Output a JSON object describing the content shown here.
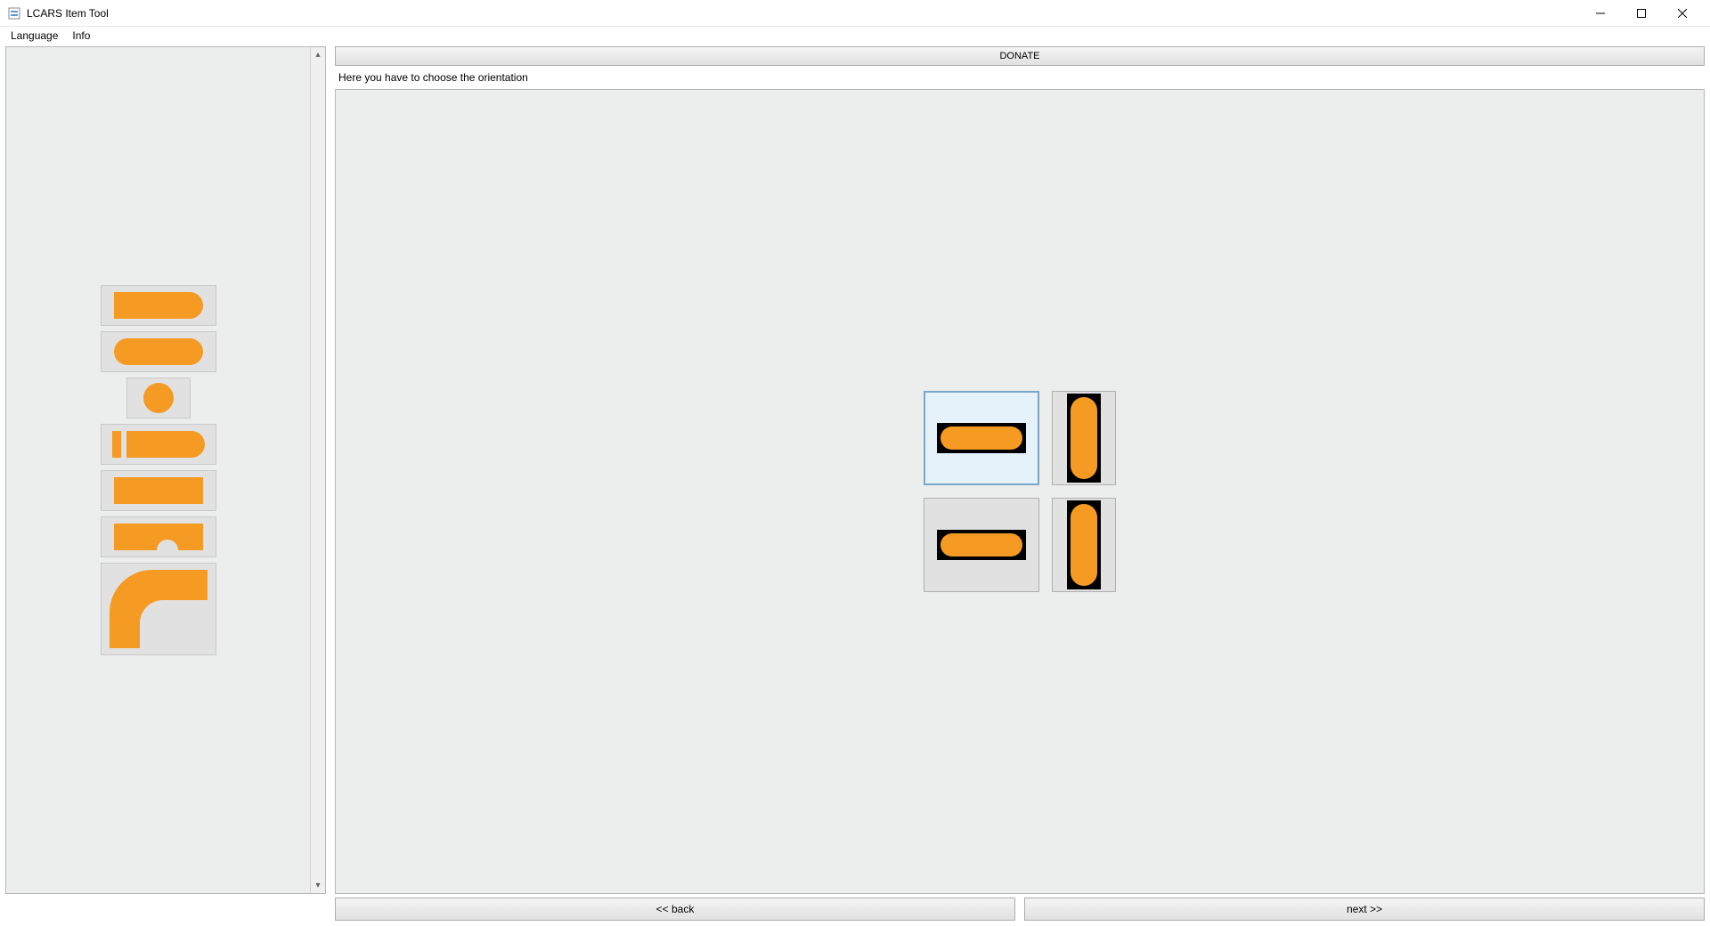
{
  "window": {
    "title": "LCARS Item Tool"
  },
  "menu": {
    "language": "Language",
    "info": "Info"
  },
  "main": {
    "donate": "DONATE",
    "instruction": "Here you have to choose the orientation",
    "back": "<< back",
    "next": "next >>"
  },
  "colors": {
    "shape": "#f59a22"
  },
  "sidebar": {
    "shapes": [
      "rounded-right-bar",
      "pill-bar",
      "circle",
      "split-bar",
      "rectangle-bar",
      "notched-bar",
      "elbow-curve"
    ]
  },
  "orientation": {
    "options": [
      "horizontal-1",
      "vertical-1",
      "horizontal-2",
      "vertical-2"
    ],
    "selected": "horizontal-1"
  }
}
